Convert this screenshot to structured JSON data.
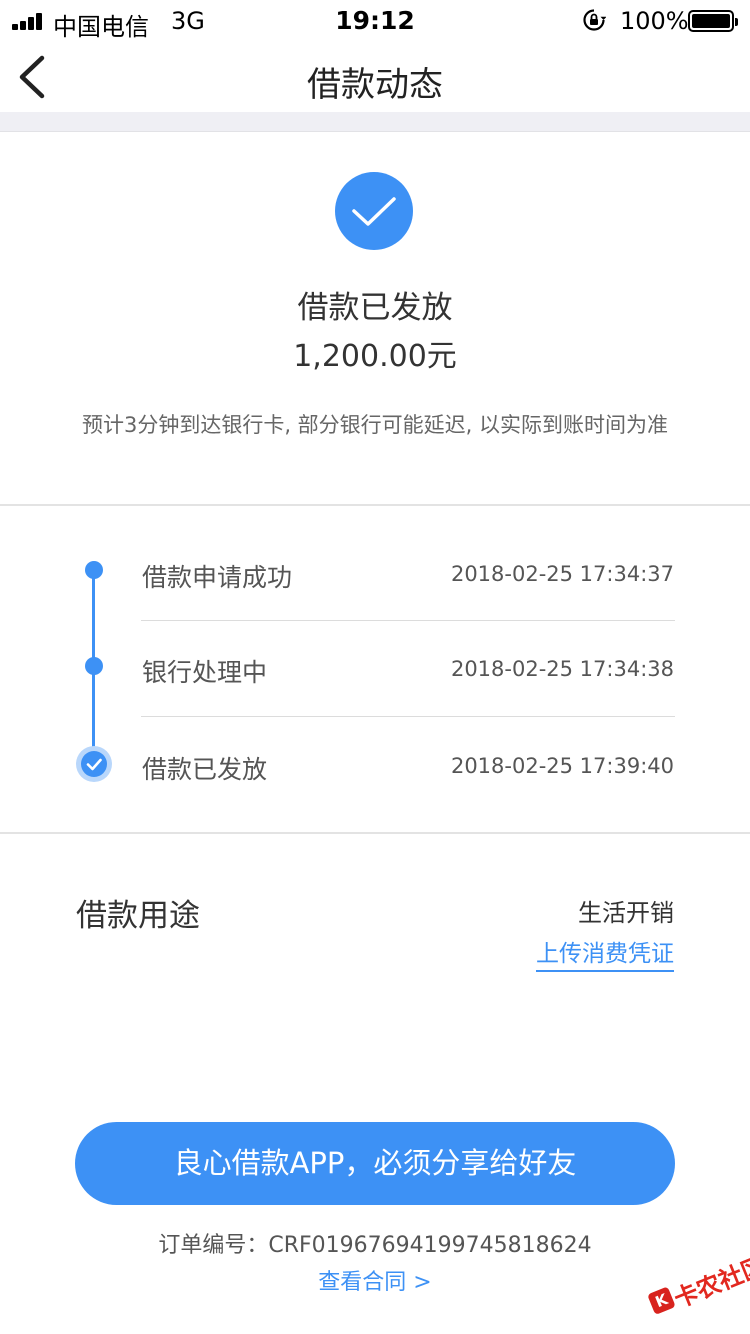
{
  "status_bar": {
    "carrier": "中国电信",
    "network": "3G",
    "time": "19:12",
    "battery": "100%"
  },
  "nav": {
    "title": "借款动态",
    "back_icon": "chevron-left-icon"
  },
  "header": {
    "status_icon": "check-circle-icon",
    "status": "借款已发放",
    "amount": "1,200.00元",
    "note": "预计3分钟到达银行卡, 部分银行可能延迟, 以实际到账时间为准"
  },
  "timeline": [
    {
      "label": "借款申请成功",
      "time": "2018-02-25 17:34:37"
    },
    {
      "label": "银行处理中",
      "time": "2018-02-25 17:34:38"
    },
    {
      "label": "借款已发放",
      "time": "2018-02-25 17:39:40"
    }
  ],
  "purpose": {
    "label": "借款用途",
    "value": "生活开销",
    "upload_link": "上传消费凭证"
  },
  "footer": {
    "share_button": "良心借款APP，必须分享给好友",
    "order_text": "订单编号：CRF01967694199745818624",
    "contract_link": "查看合同 >"
  },
  "watermark": {
    "text": "卡农社区",
    "mark": "K"
  },
  "colors": {
    "accent": "#3d91f5",
    "divider": "#e3e3e3",
    "band": "#efeff4"
  }
}
